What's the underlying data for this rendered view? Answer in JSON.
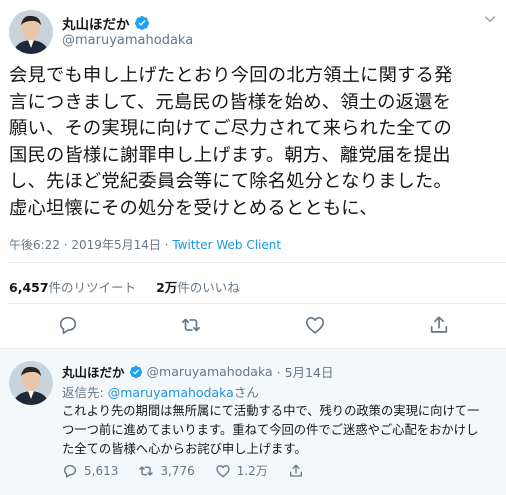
{
  "tweet": {
    "name": "丸山ほだか",
    "handle": "@maruyamahodaka",
    "text_lines": [
      "会見でも申し上げたとおり今回の北方領土に関する発",
      "言につきまして、元島民の皆様を始め、領土の返還を",
      "願い、その実現に向けてご尽力されて来られた全ての",
      "国民の皆様に謝罪申し上げます。朝方、離党届を提出",
      "し、先ほど党紀委員会等にて除名処分となりました。",
      "虚心坦懐にその処分を受けとめるとともに、"
    ],
    "time": "午後6:22",
    "date": "2019年5月14日",
    "separator": " · ",
    "client": "Twitter Web Client",
    "retweets_count": "6,457",
    "retweets_label": "件のリツイート",
    "likes_count": "2万",
    "likes_label": "件のいいね"
  },
  "reply": {
    "name": "丸山ほだか",
    "handle": "@maruyamahodaka",
    "date": "· 5月14日",
    "reply_to_label": "返信先: ",
    "reply_to_handle": "@maruyamahodaka",
    "reply_to_suffix": "さん",
    "text_lines": [
      "これより先の期間は無所属にて活動する中で、残りの政策の実現に向けて一",
      "つ一つ前に進めてまいります。重ねて今回の件でご迷惑やご心配をおかけし",
      "た全ての皆様へ心からお詫び申し上げます。"
    ],
    "replies": "5,613",
    "retweets": "3,776",
    "likes": "1.2万"
  },
  "colors": {
    "text": "#14171a",
    "secondary": "#657786",
    "link": "#1b95e0",
    "verified": "#1da1f2",
    "reply_bg": "#f5f8fa"
  },
  "icons": [
    "verified-badge-icon",
    "chevron-down-icon",
    "reply-icon",
    "retweet-icon",
    "like-icon",
    "share-icon",
    "dm-icon"
  ]
}
